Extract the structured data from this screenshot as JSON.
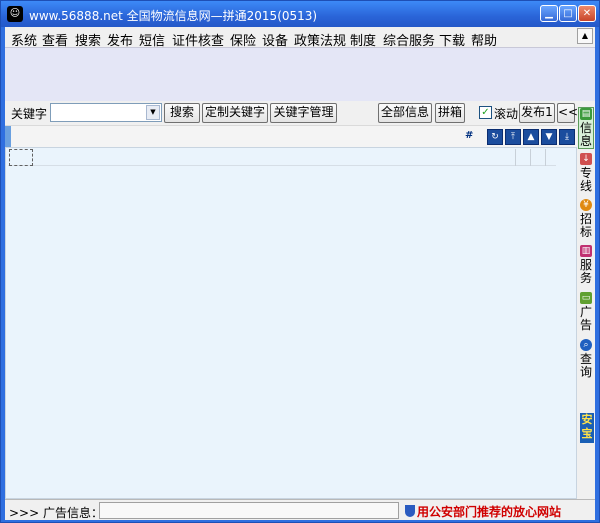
{
  "window": {
    "title": "www.56888.net 全国物流信息网—拼通2015(0513)",
    "icon": "app-logo-icon"
  },
  "menu": [
    "系统",
    "查看",
    "搜索",
    "发布",
    "短信",
    "证件核查",
    "保险",
    "设备",
    "政策法规",
    "制度",
    "综合服务",
    "下载",
    "帮助"
  ],
  "toolbar": {
    "keyword_label": "关键字",
    "keyword_value": "",
    "search": "搜索",
    "custom_keyword": "定制关键字",
    "keyword_manage": "关键字管理",
    "all_info": "全部信息",
    "consolidate": "拼箱",
    "scroll_label": "滚动",
    "scroll_checked": true,
    "publish": "发布1",
    "collapse": "<<"
  },
  "grid": {
    "hash": "#"
  },
  "side_tabs": [
    {
      "label": "信息",
      "icon": "document-icon",
      "color": "#3c9a3c"
    },
    {
      "label": "专线",
      "icon": "download-icon",
      "color": "#d05050"
    },
    {
      "label": "招标",
      "icon": "yen-icon",
      "color": "#e08a10"
    },
    {
      "label": "服务",
      "icon": "books-icon",
      "color": "#c03070"
    },
    {
      "label": "广告",
      "icon": "monitor-icon",
      "color": "#60a030"
    },
    {
      "label": "查询",
      "icon": "magnifier-icon",
      "color": "#2060c0"
    }
  ],
  "anbao": "安宝",
  "status": {
    "ad_label": ">>>  广告信息：",
    "police_text": "用公安部门推荐的放心网站"
  },
  "colors": {
    "titlebar": "#2a64d8",
    "grid_bg": "#eaf4fc",
    "banner_bg": "#e4e6f6",
    "police_text": "#d00000"
  }
}
